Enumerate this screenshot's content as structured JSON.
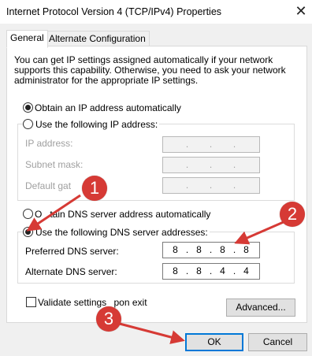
{
  "window": {
    "title": "Internet Protocol Version 4 (TCP/IPv4) Properties",
    "close_glyph": "✕"
  },
  "tabs": [
    {
      "label": "General",
      "selected": true
    },
    {
      "label": "Alternate Configuration",
      "selected": false
    }
  ],
  "description": "You can get IP settings assigned automatically if your network supports this capability. Otherwise, you need to ask your network administrator for the appropriate IP settings.",
  "ip": {
    "auto_label": "Obtain an IP address automatically",
    "auto_selected": true,
    "manual_label": "Use the following IP address:",
    "fields": [
      {
        "label": "IP address:",
        "value": [
          ".",
          ".",
          "."
        ]
      },
      {
        "label": "Subnet mask:",
        "value": [
          ".",
          ".",
          "."
        ]
      },
      {
        "label": "Default gat",
        "value": [
          ".",
          ".",
          "."
        ]
      }
    ]
  },
  "dns": {
    "auto_label_a": "O",
    "auto_label_b": "tain DNS server address automatically",
    "manual_label": "Use the following DNS server addresses:",
    "manual_selected": true,
    "preferred": {
      "label": "Preferred DNS server:",
      "octets": [
        "8",
        "8",
        "8",
        "8"
      ],
      "dots": [
        ".",
        ".",
        "."
      ]
    },
    "alternate": {
      "label": "Alternate DNS server:",
      "octets": [
        "8",
        "8",
        "4",
        "4"
      ],
      "dots": [
        ".",
        ".",
        "."
      ]
    }
  },
  "validate": {
    "label_a": "Validate settings ",
    "label_b": "pon exit",
    "checked": false
  },
  "buttons": {
    "advanced": "Advanced...",
    "ok": "OK",
    "cancel": "Cancel"
  },
  "annotations": {
    "color": "#d63a35",
    "badges": [
      "1",
      "2",
      "3"
    ]
  }
}
